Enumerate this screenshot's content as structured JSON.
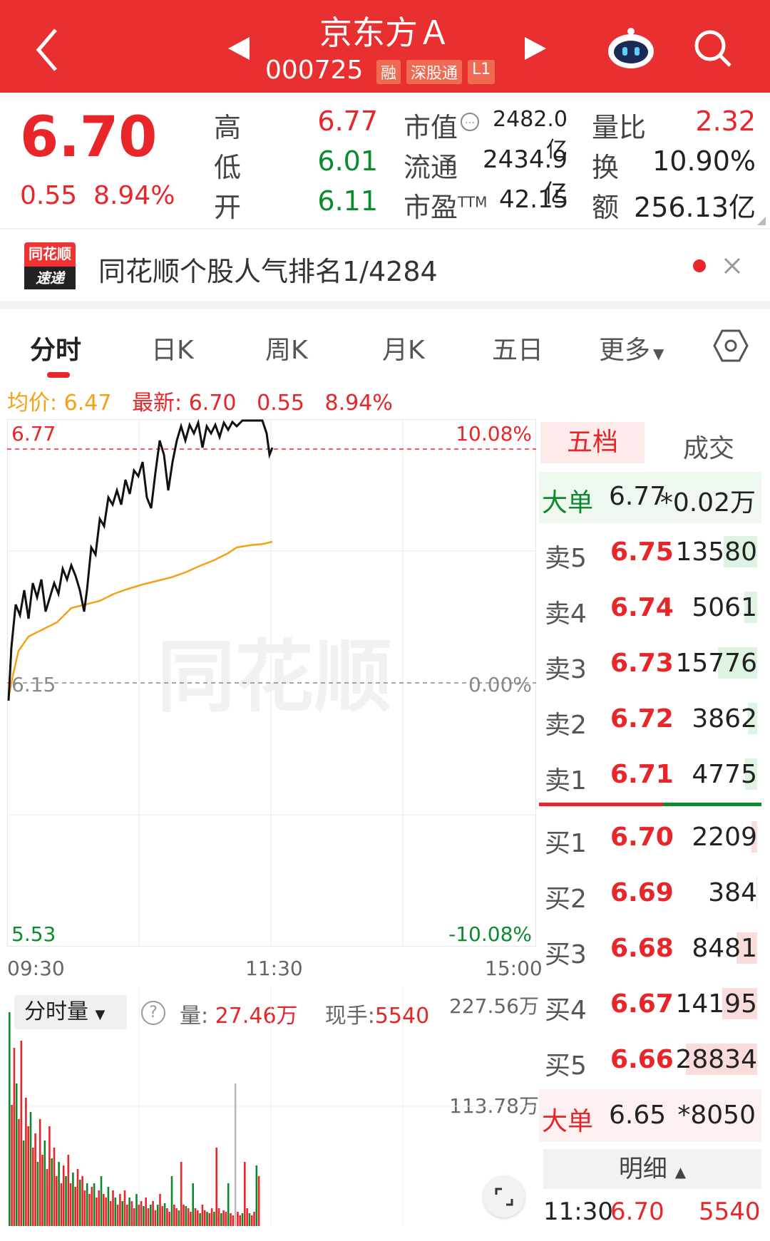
{
  "header": {
    "title": "京东方Ａ",
    "code": "000725",
    "tags": [
      "融",
      "深股通",
      "L1"
    ]
  },
  "quote": {
    "price": "6.70",
    "change": "0.55",
    "change_pct": "8.94%",
    "high_label": "高",
    "high": "6.77",
    "low_label": "低",
    "low": "6.01",
    "open_label": "开",
    "open": "6.11",
    "mktcap_label": "市值",
    "mktcap": "2482.0亿",
    "float_label": "流通",
    "float": "2434.9亿",
    "pe_label": "市盈",
    "pe_sup": "TTM",
    "pe": "42.15",
    "volratio_label": "量比",
    "volratio": "2.32",
    "turnover_label": "换",
    "turnover": "10.90%",
    "amount_label": "额",
    "amount": "256.13亿"
  },
  "news": {
    "logo_top": "同花顺",
    "logo_bottom": "速递",
    "text": "同花顺个股人气排名1/4284"
  },
  "tabs": [
    "分时",
    "日K",
    "周K",
    "月K",
    "五日",
    "更多"
  ],
  "chart": {
    "avg_label": "均价:",
    "avg": "6.47",
    "latest_label": "最新:",
    "latest": "6.70",
    "latest_chg": "0.55",
    "latest_pct": "8.94%",
    "y_top": "6.77",
    "y_mid": "6.15",
    "y_bot": "5.53",
    "pct_top": "10.08%",
    "pct_mid": "0.00%",
    "pct_bot": "-10.08%",
    "time_start": "09:30",
    "time_mid": "11:30",
    "time_end": "15:00",
    "watermark": "同花顺",
    "vol_select": "分时量",
    "vol_label": "量:",
    "vol": "27.46万",
    "hand_label": "现手:",
    "hand": "5540",
    "vol_max": "227.56万",
    "vol_mid": "113.78万"
  },
  "orderbook": {
    "tab_active": "五档",
    "tab_other": "成交",
    "big_sell": {
      "k": "大单",
      "p": "6.77",
      "v": "*0.02万"
    },
    "asks": [
      {
        "k": "卖5",
        "p": "6.75",
        "v": "13580",
        "ratio": 0.47
      },
      {
        "k": "卖4",
        "p": "6.74",
        "v": "5061",
        "ratio": 0.18
      },
      {
        "k": "卖3",
        "p": "6.73",
        "v": "15776",
        "ratio": 0.55
      },
      {
        "k": "卖2",
        "p": "6.72",
        "v": "3862",
        "ratio": 0.13
      },
      {
        "k": "卖1",
        "p": "6.71",
        "v": "4775",
        "ratio": 0.17
      }
    ],
    "bids": [
      {
        "k": "买1",
        "p": "6.70",
        "v": "2209",
        "ratio": 0.08
      },
      {
        "k": "买2",
        "p": "6.69",
        "v": "384",
        "ratio": 0.01
      },
      {
        "k": "买3",
        "p": "6.68",
        "v": "8481",
        "ratio": 0.29
      },
      {
        "k": "买4",
        "p": "6.67",
        "v": "14195",
        "ratio": 0.49
      },
      {
        "k": "买5",
        "p": "6.66",
        "v": "28834",
        "ratio": 1.0
      }
    ],
    "big_buy": {
      "k": "大单",
      "p": "6.65",
      "v": "*8050"
    },
    "detail_label": "明细",
    "detail_time": "11:30",
    "detail_price": "6.70",
    "detail_vol": "5540"
  },
  "colors": {
    "brand": "#e93030",
    "up": "#e8262a",
    "down": "#0b8a2e",
    "avg": "#f5a015"
  }
}
